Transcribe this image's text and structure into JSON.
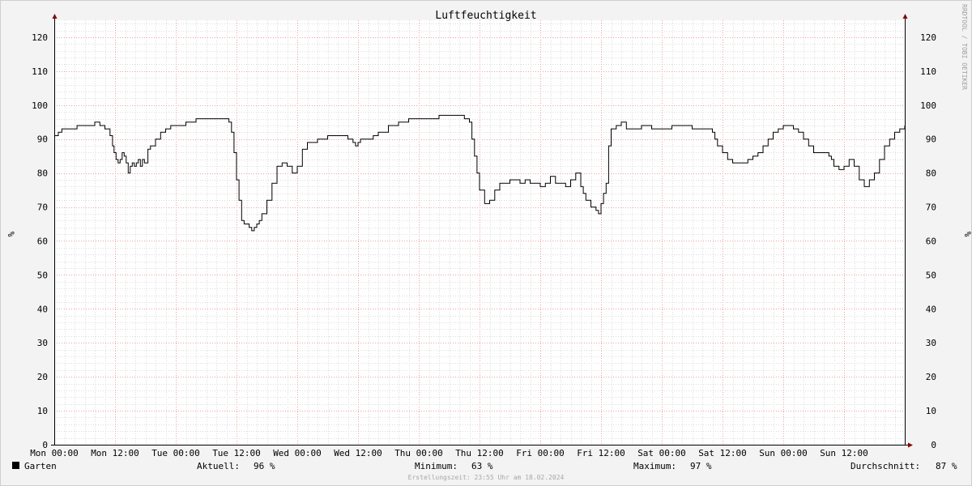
{
  "chart_data": {
    "type": "line",
    "title": "Luftfeuchtigkeit",
    "ylabel": "%",
    "ylim": [
      0,
      125
    ],
    "yticks": [
      0,
      10,
      20,
      30,
      40,
      50,
      60,
      70,
      80,
      90,
      100,
      110,
      120
    ],
    "xlim_hours": [
      0,
      168
    ],
    "xticks": [
      {
        "h": 0,
        "label": "Mon 00:00"
      },
      {
        "h": 12,
        "label": "Mon 12:00"
      },
      {
        "h": 24,
        "label": "Tue 00:00"
      },
      {
        "h": 36,
        "label": "Tue 12:00"
      },
      {
        "h": 48,
        "label": "Wed 00:00"
      },
      {
        "h": 60,
        "label": "Wed 12:00"
      },
      {
        "h": 72,
        "label": "Thu 00:00"
      },
      {
        "h": 84,
        "label": "Thu 12:00"
      },
      {
        "h": 96,
        "label": "Fri 00:00"
      },
      {
        "h": 108,
        "label": "Fri 12:00"
      },
      {
        "h": 120,
        "label": "Sat 00:00"
      },
      {
        "h": 132,
        "label": "Sat 12:00"
      },
      {
        "h": 144,
        "label": "Sun 00:00"
      },
      {
        "h": 156,
        "label": "Sun 12:00"
      }
    ],
    "grid": true,
    "series": [
      {
        "name": "Garten",
        "color": "#000000",
        "x_hours": [
          0,
          0.8,
          1.5,
          3,
          4.5,
          6,
          7.5,
          8,
          9,
          10,
          11,
          11.5,
          11.8,
          12.2,
          12.6,
          13.0,
          13.4,
          13.8,
          14.2,
          14.6,
          15.0,
          15.4,
          15.8,
          16.2,
          16.6,
          17.0,
          17.4,
          17.8,
          18.5,
          19,
          20,
          21,
          22,
          23,
          24,
          26,
          28,
          30,
          32,
          34,
          34.5,
          35,
          35.5,
          36,
          36.5,
          37,
          37.5,
          38,
          38.5,
          39,
          39.5,
          40,
          40.5,
          41,
          42,
          43,
          44,
          45,
          46,
          47,
          48,
          49,
          50,
          51,
          52,
          53,
          54,
          56,
          58,
          59,
          59.5,
          60,
          60.5,
          61,
          62,
          63,
          64,
          66,
          68,
          70,
          72,
          74,
          76,
          78,
          79,
          80,
          81,
          82,
          82.5,
          83,
          83.5,
          84,
          85,
          86,
          87,
          88,
          90,
          91,
          92,
          93,
          94,
          95,
          96,
          97,
          98,
          99,
          100,
          101,
          102,
          103,
          104,
          104.5,
          105,
          106,
          107,
          107.5,
          108,
          108.5,
          109,
          109.5,
          110,
          111,
          112,
          113,
          114,
          116,
          118,
          120,
          122,
          124,
          126,
          127,
          128,
          129,
          130,
          130.5,
          131,
          132,
          133,
          134,
          135,
          136,
          137,
          138,
          139,
          140,
          141,
          142,
          143,
          144,
          145,
          146,
          147,
          148,
          149,
          150,
          151,
          152,
          153,
          153.5,
          154,
          155,
          156,
          157,
          158,
          159,
          160,
          161,
          162,
          163,
          164,
          165,
          166,
          167,
          168
        ],
        "values": [
          91,
          92,
          93,
          93,
          94,
          94,
          94,
          95,
          94,
          93,
          91,
          88,
          86,
          84,
          83,
          84,
          86,
          85,
          83,
          80,
          82,
          83,
          82,
          83,
          84,
          82,
          84,
          83,
          87,
          88,
          90,
          92,
          93,
          94,
          94,
          95,
          96,
          96,
          96,
          96,
          95,
          92,
          86,
          78,
          72,
          66,
          65,
          65,
          64,
          63,
          64,
          65,
          66,
          68,
          72,
          77,
          82,
          83,
          82,
          80,
          82,
          87,
          89,
          89,
          90,
          90,
          91,
          91,
          90,
          89,
          88,
          89,
          90,
          90,
          90,
          91,
          92,
          94,
          95,
          96,
          96,
          96,
          97,
          97,
          97,
          97,
          96,
          95,
          90,
          85,
          80,
          75,
          71,
          72,
          75,
          77,
          78,
          78,
          77,
          78,
          77,
          77,
          76,
          77,
          79,
          77,
          77,
          76,
          78,
          80,
          76,
          74,
          72,
          70,
          69,
          68,
          71,
          74,
          77,
          88,
          93,
          94,
          95,
          93,
          93,
          94,
          93,
          93,
          94,
          94,
          93,
          93,
          93,
          93,
          92,
          90,
          88,
          86,
          84,
          83,
          83,
          83,
          84,
          85,
          86,
          88,
          90,
          92,
          93,
          94,
          94,
          93,
          92,
          90,
          88,
          86,
          86,
          86,
          85,
          84,
          82,
          81,
          82,
          84,
          82,
          78,
          76,
          78,
          80,
          84,
          88,
          90,
          92,
          93,
          94,
          95,
          91,
          94,
          96
        ]
      }
    ],
    "legend": {
      "label": "Garten",
      "color": "#000000"
    },
    "stats": [
      {
        "label": "Aktuell:",
        "value": "96 %"
      },
      {
        "label": "Minimum:",
        "value": "63 %"
      },
      {
        "label": "Maximum:",
        "value": "97 %"
      },
      {
        "label": "Durchschnitt:",
        "value": "87 %"
      }
    ],
    "watermark": "RRDTOOL / TOBI OETIKER",
    "footer": "Erstellungszeit: 23:55 Uhr am 18.02.2024"
  }
}
